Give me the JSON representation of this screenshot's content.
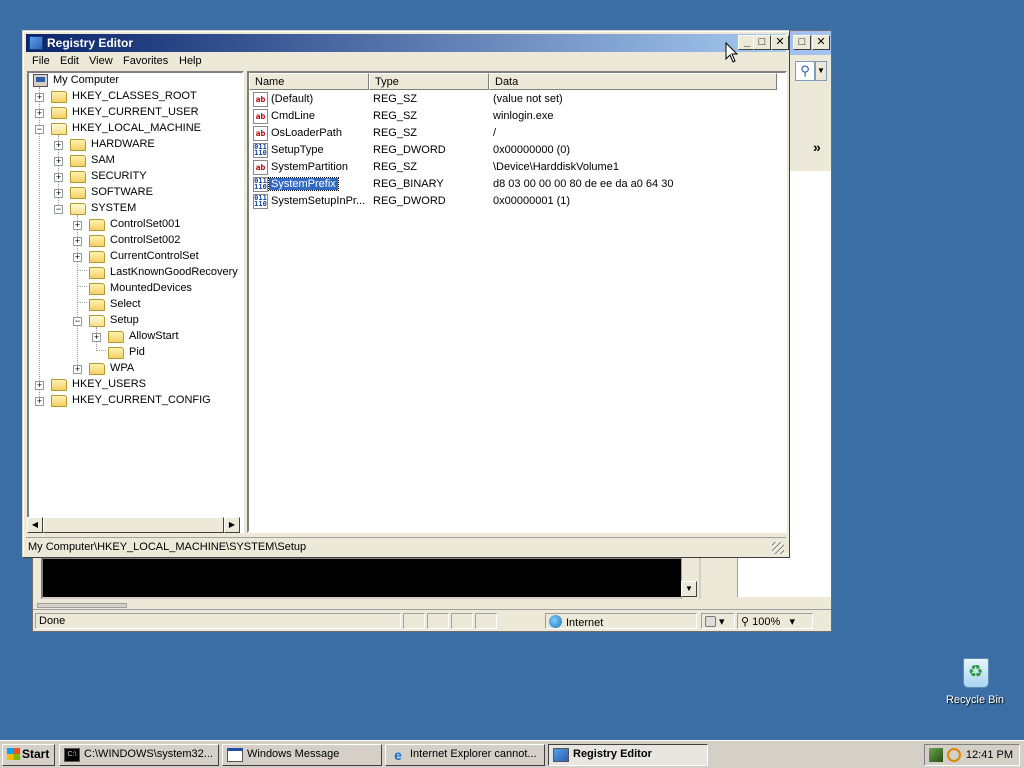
{
  "desktop": {
    "background_color": "#3a6ea5",
    "recycle_bin_label": "Recycle Bin"
  },
  "ie_window": {
    "status_text": "Done",
    "zone_label": "Internet",
    "zoom_label": "100%",
    "search_icon": "search-icon",
    "chevron": "»"
  },
  "regedit": {
    "title": "Registry Editor",
    "caption_buttons": {
      "minimize": "_",
      "maximize": "□",
      "close": "✕"
    },
    "menu": [
      "File",
      "Edit",
      "View",
      "Favorites",
      "Help"
    ],
    "tree": {
      "root": "My Computer",
      "items": [
        {
          "label": "HKEY_CLASSES_ROOT",
          "expander": "+"
        },
        {
          "label": "HKEY_CURRENT_USER",
          "expander": "+"
        },
        {
          "label": "HKEY_LOCAL_MACHINE",
          "expander": "−"
        },
        {
          "label": "HARDWARE",
          "expander": "+"
        },
        {
          "label": "SAM",
          "expander": "+"
        },
        {
          "label": "SECURITY",
          "expander": "+"
        },
        {
          "label": "SOFTWARE",
          "expander": "+"
        },
        {
          "label": "SYSTEM",
          "expander": "−"
        },
        {
          "label": "ControlSet001",
          "expander": "+"
        },
        {
          "label": "ControlSet002",
          "expander": "+"
        },
        {
          "label": "CurrentControlSet",
          "expander": "+"
        },
        {
          "label": "LastKnownGoodRecovery",
          "expander": ""
        },
        {
          "label": "MountedDevices",
          "expander": ""
        },
        {
          "label": "Select",
          "expander": ""
        },
        {
          "label": "Setup",
          "expander": "−"
        },
        {
          "label": "AllowStart",
          "expander": "+"
        },
        {
          "label": "Pid",
          "expander": ""
        },
        {
          "label": "WPA",
          "expander": "+"
        },
        {
          "label": "HKEY_USERS",
          "expander": "+"
        },
        {
          "label": "HKEY_CURRENT_CONFIG",
          "expander": "+"
        }
      ]
    },
    "columns": [
      "Name",
      "Type",
      "Data"
    ],
    "values": [
      {
        "name": "(Default)",
        "type": "REG_SZ",
        "data": "(value not set)",
        "icon": "ab"
      },
      {
        "name": "CmdLine",
        "type": "REG_SZ",
        "data": "winlogin.exe",
        "icon": "ab"
      },
      {
        "name": "OsLoaderPath",
        "type": "REG_SZ",
        "data": "/",
        "icon": "ab"
      },
      {
        "name": "SetupType",
        "type": "REG_DWORD",
        "data": "0x00000000 (0)",
        "icon": "binary"
      },
      {
        "name": "SystemPartition",
        "type": "REG_SZ",
        "data": "\\Device\\HarddiskVolume1",
        "icon": "ab"
      },
      {
        "name": "SystemPrefix",
        "type": "REG_BINARY",
        "data": "d8 03 00 00 00 80 de ee da a0 64 30",
        "icon": "binary",
        "selected": true
      },
      {
        "name": "SystemSetupInPr...",
        "type": "REG_DWORD",
        "data": "0x00000001 (1)",
        "icon": "binary"
      }
    ],
    "status_path": "My Computer\\HKEY_LOCAL_MACHINE\\SYSTEM\\Setup",
    "selection_color": "#316ac5"
  },
  "taskbar": {
    "start_label": "Start",
    "tasks": [
      {
        "label": "C:\\WINDOWS\\system32...",
        "active": false
      },
      {
        "label": "Windows Message",
        "active": false
      },
      {
        "label": "Internet Explorer cannot...",
        "active": false
      },
      {
        "label": "Registry Editor",
        "active": true
      }
    ],
    "clock": "12:41 PM"
  }
}
